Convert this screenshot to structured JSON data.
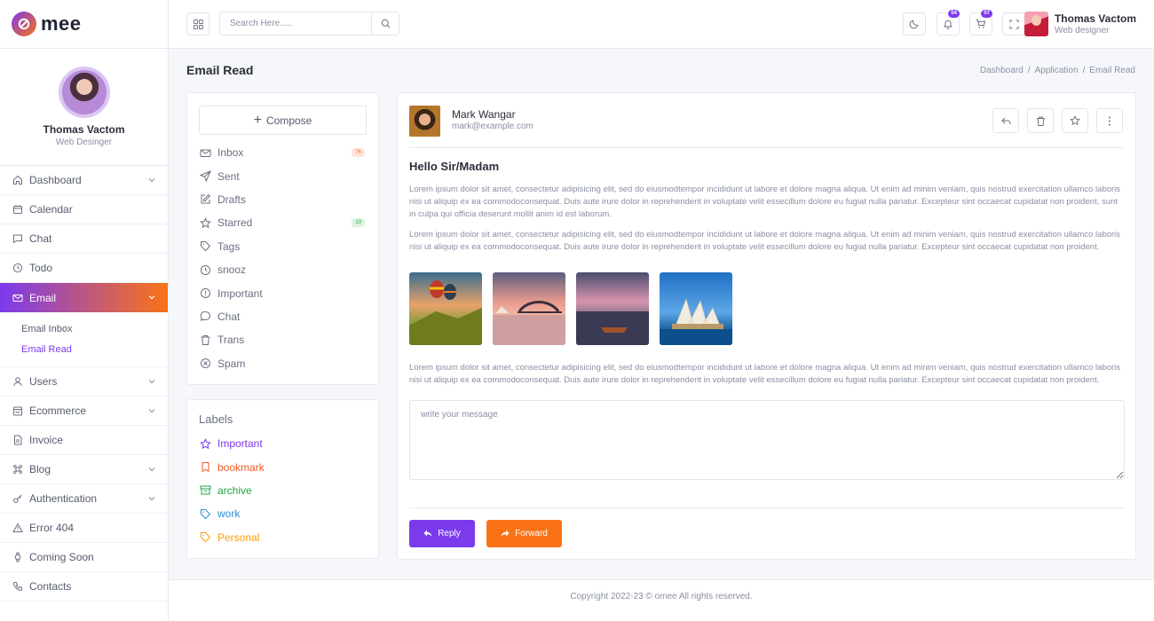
{
  "app": {
    "logo_text": "mee"
  },
  "sidebar": {
    "profile": {
      "name": "Thomas Vactom",
      "role": "Web Desinger"
    },
    "items": [
      {
        "label": "Dashboard",
        "icon": "home-icon",
        "chevron": true
      },
      {
        "label": "Calendar",
        "icon": "calendar-icon",
        "chevron": false
      },
      {
        "label": "Chat",
        "icon": "chat-icon",
        "chevron": false
      },
      {
        "label": "Todo",
        "icon": "clock-icon",
        "chevron": false
      },
      {
        "label": "Email",
        "icon": "mail-icon",
        "chevron": true,
        "active": true
      },
      {
        "label": "Users",
        "icon": "user-icon",
        "chevron": true
      },
      {
        "label": "Ecommerce",
        "icon": "shopping-bag-icon",
        "chevron": true
      },
      {
        "label": "Invoice",
        "icon": "file-icon",
        "chevron": false
      },
      {
        "label": "Blog",
        "icon": "command-icon",
        "chevron": true
      },
      {
        "label": "Authentication",
        "icon": "key-icon",
        "chevron": true
      },
      {
        "label": "Error 404",
        "icon": "alert-triangle-icon",
        "chevron": false
      },
      {
        "label": "Coming Soon",
        "icon": "watch-icon",
        "chevron": false
      },
      {
        "label": "Contacts",
        "icon": "phone-icon",
        "chevron": false
      }
    ],
    "email_submenu": [
      {
        "label": "Email Inbox"
      },
      {
        "label": "Email Read",
        "selected": true
      }
    ]
  },
  "header": {
    "search_placeholder": "Search Here.....",
    "notification_count": "04",
    "cart_count": "07",
    "user": {
      "name": "Thomas Vactom",
      "role": "Web designer"
    }
  },
  "page": {
    "title": "Email Read",
    "breadcrumb": [
      "Dashboard",
      "Application",
      "Email Read"
    ]
  },
  "mailbox": {
    "compose_label": "Compose",
    "folders": [
      {
        "label": "Inbox",
        "icon": "mail-icon",
        "count": "76",
        "count_color": "red"
      },
      {
        "label": "Sent",
        "icon": "send-icon"
      },
      {
        "label": "Drafts",
        "icon": "edit-icon"
      },
      {
        "label": "Starred",
        "icon": "star-icon",
        "count": "10",
        "count_color": "green"
      },
      {
        "label": "Tags",
        "icon": "tag-icon"
      },
      {
        "label": "snooz",
        "icon": "clock-icon"
      },
      {
        "label": "Important",
        "icon": "alert-circle-icon"
      },
      {
        "label": "Chat",
        "icon": "chat-icon"
      },
      {
        "label": "Trans",
        "icon": "trash-icon"
      },
      {
        "label": "Spam",
        "icon": "x-circle-icon"
      }
    ]
  },
  "labels": {
    "title": "Labels",
    "items": [
      {
        "label": "Important",
        "icon": "star-icon",
        "color": "#7c3aed"
      },
      {
        "label": "bookmark",
        "icon": "bookmark-icon",
        "color": "#f05a28"
      },
      {
        "label": "archive",
        "icon": "archive-icon",
        "color": "#22a447"
      },
      {
        "label": "work",
        "icon": "tag-icon",
        "color": "#2b8fd6"
      },
      {
        "label": "Personal",
        "icon": "tag-icon",
        "color": "#f59e0b"
      }
    ]
  },
  "email": {
    "sender_name": "Mark Wangar",
    "sender_email": "mark@example.com",
    "subject": "Hello Sir/Madam",
    "paragraph1": "Lorem ipsum dolor sit amet, consectetur adipisicing elit, sed do eiusmodtempor incididunt ut labore et dolore magna aliqua. Ut enim ad minim veniam, quis nostrud exercitation ullamco laboris nisi ut aliquip ex ea commodoconsequat. Duis aute irure dolor in reprehenderit in voluptate velit essecillum dolore eu fugiat nulla pariatur. Excepteur sint occaecat cupidatat non proident, sunt in culpa qui officia deserunt mollit anim id est laborum.",
    "paragraph2": "Lorem ipsum dolor sit amet, consectetur adipisicing elit, sed do eiusmodtempor incididunt ut labore et dolore magna aliqua. Ut enim ad minim veniam, quis nostrud exercitation ullamco laboris nisi ut aliquip ex ea commodoconsequat. Duis aute irure dolor in reprehenderit in voluptate velit essecillum dolore eu fugiat nulla pariatur. Excepteur sint occaecat cupidatat non proident.",
    "paragraph3": "Lorem ipsum dolor sit amet, consectetur adipisicing elit, sed do eiusmodtempor incididunt ut labore et dolore magna aliqua. Ut enim ad minim veniam, quis nostrud exercitation ullamco laboris nisi ut aliquip ex ea commodoconsequat. Duis aute irure dolor in reprehenderit in voluptate velit essecillum dolore eu fugiat nulla pariatur. Excepteur sint occaecat cupidatat non proident.",
    "attachments": [
      "hot-air-balloons",
      "sydney-harbour-bridge",
      "boat-on-lake",
      "sydney-opera-house"
    ],
    "message_placeholder": "write your message",
    "reply_label": "Reply",
    "forward_label": "Forward"
  },
  "footer": {
    "text": "Copyright 2022-23 © omee All rights reserved."
  },
  "colors": {
    "primary": "#7c3aed",
    "accent": "#f97316"
  }
}
